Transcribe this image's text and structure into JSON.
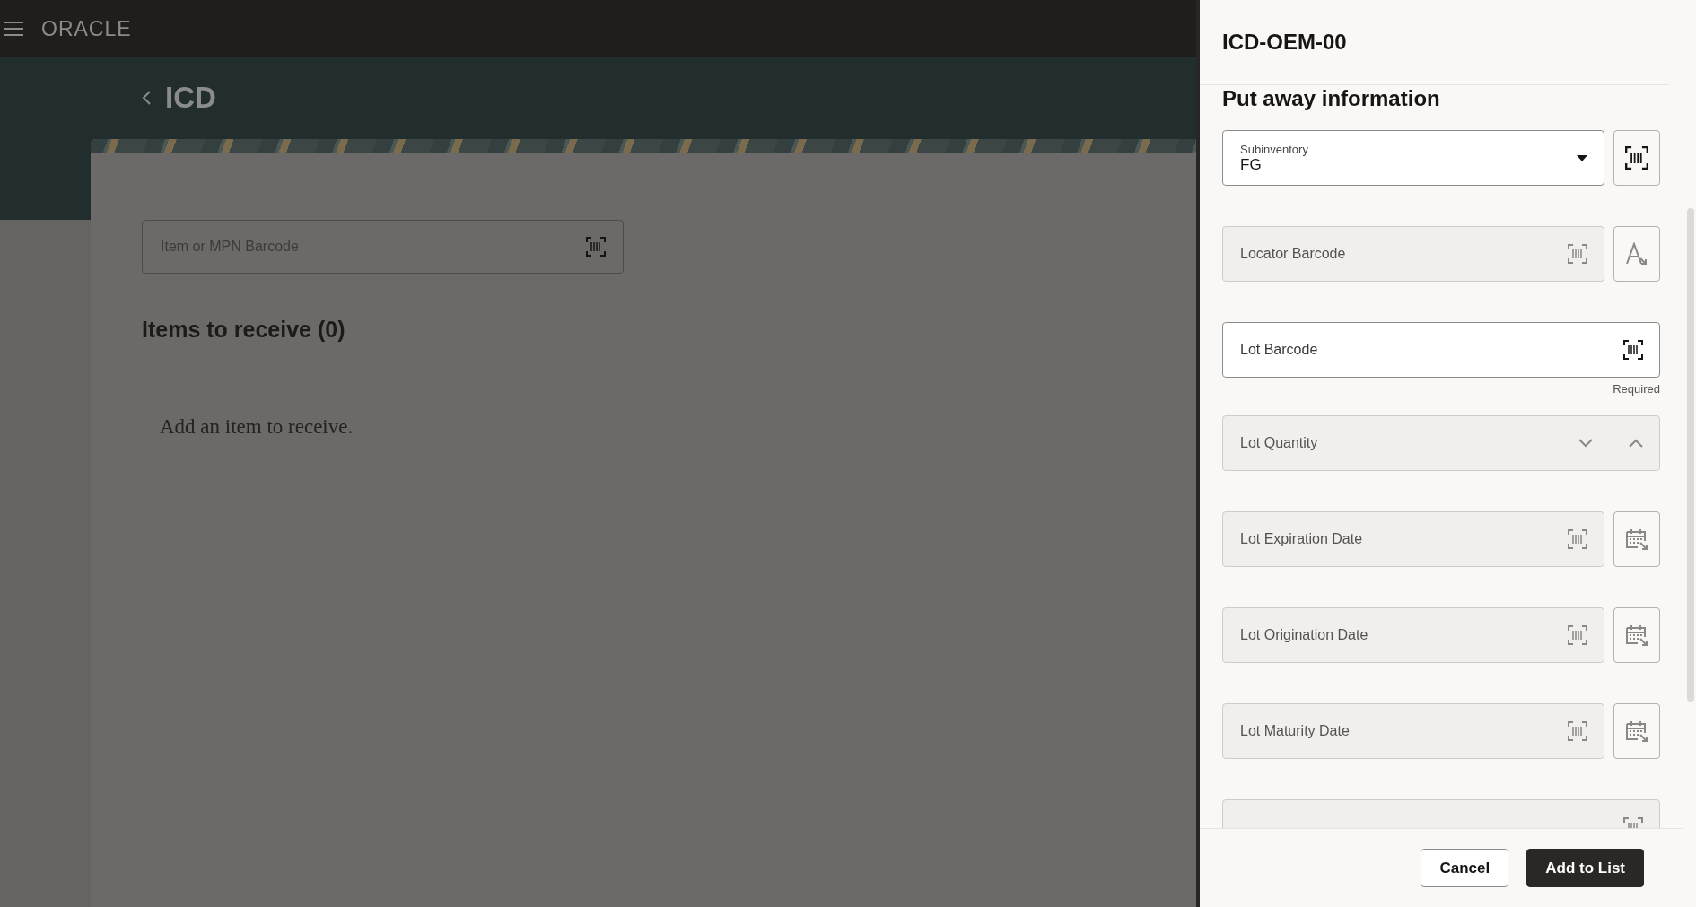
{
  "app_bar": {
    "logo": "ORACLE"
  },
  "page": {
    "title": "ICD",
    "search": {
      "placeholder": "Item or MPN Barcode"
    },
    "section_title": "Items to receive (0)",
    "empty_message": "Add an item to receive."
  },
  "drawer": {
    "title": "ICD-OEM-00",
    "section_title": "Put away information",
    "fields": [
      {
        "kind": "select",
        "label": "Subinventory",
        "value": "FG",
        "disabled": false,
        "side_button": {
          "kind": "scan"
        }
      },
      {
        "kind": "barcode",
        "label": "Locator Barcode",
        "disabled": true,
        "side_button": {
          "kind": "format"
        }
      },
      {
        "kind": "barcode",
        "label": "Lot Barcode",
        "disabled": false,
        "helper": "Required"
      },
      {
        "kind": "number",
        "label": "Lot Quantity",
        "disabled": true
      },
      {
        "kind": "barcode",
        "label": "Lot Expiration Date",
        "disabled": true,
        "side_button": {
          "kind": "calendar"
        }
      },
      {
        "kind": "barcode",
        "label": "Lot Origination Date",
        "disabled": true,
        "side_button": {
          "kind": "calendar"
        }
      },
      {
        "kind": "barcode",
        "label": "Lot Maturity Date",
        "disabled": true,
        "side_button": {
          "kind": "calendar"
        }
      },
      {
        "kind": "barcode",
        "disabled": true
      }
    ],
    "footer_buttons": [
      {
        "label": "Cancel",
        "primary": false
      },
      {
        "label": "Add to List",
        "primary": true
      }
    ]
  }
}
